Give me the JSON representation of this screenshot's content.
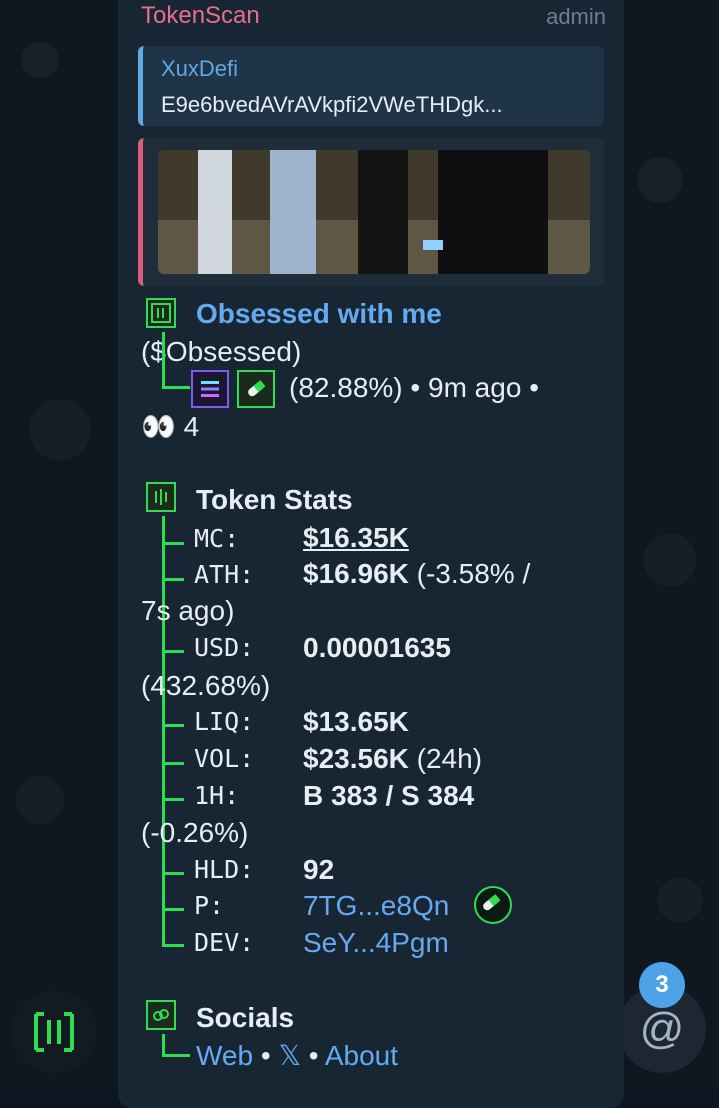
{
  "message": {
    "sender": "TokenScan",
    "role": "admin",
    "reply": {
      "name": "XuxDefi",
      "text": "E9e6bvedAVrAVkpfi2VWeTHDgk..."
    }
  },
  "token": {
    "name": "Obsessed with me",
    "ticker": "($Obsessed)",
    "percent": "(82.88%)",
    "age": "9m ago",
    "sep": "•",
    "viewers": "4"
  },
  "stats": {
    "title": "Token Stats",
    "mc_label": "MC:",
    "mc_value": "$16.35K",
    "ath_label": "ATH:",
    "ath_value": "$16.96K",
    "ath_change": "(-3.58% /",
    "ath_time": "7s ago)",
    "usd_label": "USD:",
    "usd_value": "0.00001635",
    "usd_change": "(432.68%)",
    "liq_label": "LIQ:",
    "liq_value": "$13.65K",
    "vol_label": "VOL:",
    "vol_value": "$23.56K",
    "vol_period": "(24h)",
    "h1_label": "1H:",
    "h1_value": "B 383 / S 384",
    "h1_change": "(-0.26%)",
    "hld_label": "HLD:",
    "hld_value": "92",
    "p_label": "P:",
    "p_value": "7TG...e8Qn",
    "dev_label": "DEV:",
    "dev_value": "SeY...4Pgm"
  },
  "socials": {
    "title": "Socials",
    "web": "Web",
    "x": "𝕏",
    "about": "About",
    "sep": "•"
  },
  "mentions_badge": "3",
  "mention_symbol": "@",
  "colors": {
    "accent_green": "#2fdc52",
    "link_blue": "#65aaf0",
    "sender_pink": "#e56f8f"
  }
}
